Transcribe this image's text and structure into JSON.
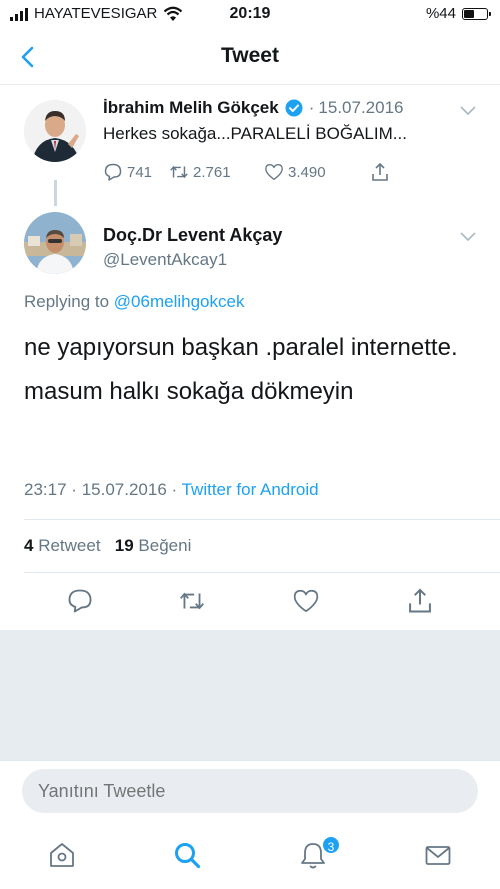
{
  "status_bar": {
    "carrier": "HAYATEVESIGAR",
    "time": "20:19",
    "battery": "%44",
    "battery_level": 0.44
  },
  "nav": {
    "title": "Tweet"
  },
  "parent_tweet": {
    "author_name": "İbrahim Melih Gökçek",
    "separator": "·",
    "date": "15.07.2016",
    "text": "Herkes sokağa...PARALELİ BOĞALIM...",
    "reply_count": "741",
    "retweet_count": "2.761",
    "like_count": "3.490"
  },
  "main_tweet": {
    "author_name": "Doç.Dr Levent Akçay",
    "handle": "@LeventAkcay1",
    "replying_prefix": "Replying to",
    "replying_to": "@06melihgokcek",
    "text": "ne yapıyorsun başkan .paralel internette. masum halkı sokağa dökmeyin",
    "time": "23:17",
    "date": "15.07.2016",
    "separator": "·",
    "source": "Twitter for Android",
    "retweets": "4",
    "retweets_label": "Retweet",
    "likes": "19",
    "likes_label": "Beğeni"
  },
  "reply_box": {
    "placeholder": "Yanıtını Tweetle"
  },
  "tabbar": {
    "notification_badge": "3"
  },
  "colors": {
    "accent": "#1da1f2",
    "text_secondary": "#657786",
    "background_gray": "#e6ecf0"
  }
}
